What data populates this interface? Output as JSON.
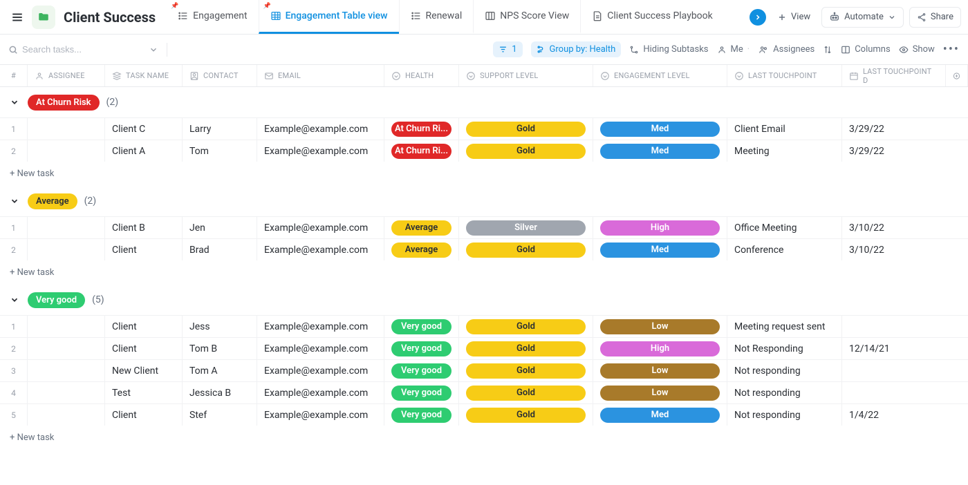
{
  "header": {
    "title": "Client Success",
    "tabs": [
      {
        "label": "Engagement",
        "icon": "list",
        "pinned": true,
        "active": false
      },
      {
        "label": "Engagement Table view",
        "icon": "table",
        "pinned": true,
        "active": true
      },
      {
        "label": "Renewal",
        "icon": "list",
        "pinned": false,
        "active": false
      },
      {
        "label": "NPS Score View",
        "icon": "board",
        "pinned": false,
        "active": false
      },
      {
        "label": "Client Success Playbook",
        "icon": "doc",
        "pinned": false,
        "active": false
      }
    ],
    "add_view_label": "View",
    "automate_label": "Automate",
    "share_label": "Share"
  },
  "toolbar": {
    "search_placeholder": "Search tasks...",
    "filter_count": "1",
    "group_by_label": "Group by: Health",
    "hiding_subtasks": "Hiding Subtasks",
    "me_label": "Me",
    "assignees_label": "Assignees",
    "columns_label": "Columns",
    "show_label": "Show"
  },
  "columns": {
    "num": "#",
    "assignee": "ASSIGNEE",
    "task_name": "TASK NAME",
    "contact": "CONTACT",
    "email": "EMAIL",
    "health": "HEALTH",
    "support": "SUPPORT LEVEL",
    "engagement": "ENGAGEMENT LEVEL",
    "last_touchpoint": "LAST TOUCHPOINT",
    "last_touchpoint_date": "LAST TOUCHPOINT D"
  },
  "new_task_label": "+ New task",
  "groups": [
    {
      "name": "At Churn Risk",
      "pill_class": "pill-red",
      "count": "(2)",
      "rows": [
        {
          "num": "1",
          "task": "Client C",
          "contact": "Larry",
          "email": "Example@example.com",
          "health": "At Churn Ri...",
          "health_class": "b-health-risk",
          "support": "Gold",
          "support_class": "b-gold",
          "engagement": "Med",
          "engagement_class": "b-med",
          "touch": "Client Email",
          "date": "3/29/22"
        },
        {
          "num": "2",
          "task": "Client A",
          "contact": "Tom",
          "email": "Example@example.com",
          "health": "At Churn Ri...",
          "health_class": "b-health-risk",
          "support": "Gold",
          "support_class": "b-gold",
          "engagement": "Med",
          "engagement_class": "b-med",
          "touch": "Meeting",
          "date": "3/29/22"
        }
      ]
    },
    {
      "name": "Average",
      "pill_class": "pill-yellow",
      "count": "(2)",
      "rows": [
        {
          "num": "1",
          "task": "Client B",
          "contact": "Jen",
          "email": "Example@example.com",
          "health": "Average",
          "health_class": "b-health-avg",
          "support": "Silver",
          "support_class": "b-silver",
          "engagement": "High",
          "engagement_class": "b-high",
          "touch": "Office Meeting",
          "date": "3/10/22"
        },
        {
          "num": "2",
          "task": "Client",
          "contact": "Brad",
          "email": "Example@example.com",
          "health": "Average",
          "health_class": "b-health-avg",
          "support": "Gold",
          "support_class": "b-gold",
          "engagement": "Med",
          "engagement_class": "b-med",
          "touch": "Conference",
          "date": "3/10/22"
        }
      ]
    },
    {
      "name": "Very good",
      "pill_class": "pill-green",
      "count": "(5)",
      "rows": [
        {
          "num": "1",
          "task": "Client",
          "contact": "Jess",
          "email": "Example@example.com",
          "health": "Very good",
          "health_class": "b-health-good",
          "support": "Gold",
          "support_class": "b-gold",
          "engagement": "Low",
          "engagement_class": "b-low",
          "touch": "Meeting request sent",
          "date": ""
        },
        {
          "num": "2",
          "task": "Client",
          "contact": "Tom B",
          "email": "Example@example.com",
          "health": "Very good",
          "health_class": "b-health-good",
          "support": "Gold",
          "support_class": "b-gold",
          "engagement": "High",
          "engagement_class": "b-high",
          "touch": "Not Responding",
          "date": "12/14/21"
        },
        {
          "num": "3",
          "task": "New Client",
          "contact": "Tom A",
          "email": "Example@example.com",
          "health": "Very good",
          "health_class": "b-health-good",
          "support": "Gold",
          "support_class": "b-gold",
          "engagement": "Low",
          "engagement_class": "b-low",
          "touch": "Not responding",
          "date": ""
        },
        {
          "num": "4",
          "task": "Test",
          "contact": "Jessica B",
          "email": "Example@example.com",
          "health": "Very good",
          "health_class": "b-health-good",
          "support": "Gold",
          "support_class": "b-gold",
          "engagement": "Low",
          "engagement_class": "b-low",
          "touch": "Not responding",
          "date": ""
        },
        {
          "num": "5",
          "task": "Client",
          "contact": "Stef",
          "email": "Example@example.com",
          "health": "Very good",
          "health_class": "b-health-good",
          "support": "Gold",
          "support_class": "b-gold",
          "engagement": "Med",
          "engagement_class": "b-med",
          "touch": "Not responding",
          "date": "1/4/22"
        }
      ]
    }
  ]
}
